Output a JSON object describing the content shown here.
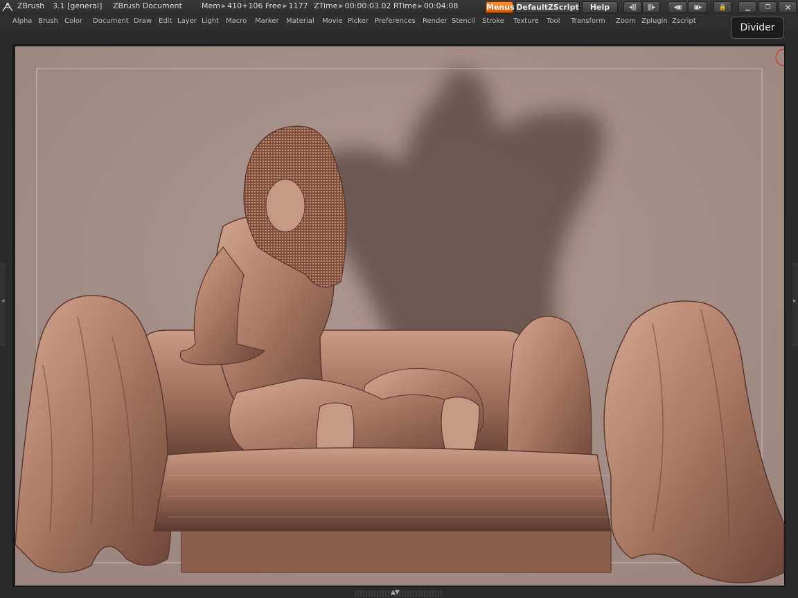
{
  "titlebar": {
    "app": "ZBrush",
    "version": "3.1 [general]",
    "document": "ZBrush Document",
    "mem_label": "Mem",
    "mem_value": "410+106",
    "free_label": "Free",
    "free_value": "1177",
    "ztime_label": "ZTime",
    "ztime_value": "00:00:03.02",
    "rtime_label": "RTime",
    "rtime_value": "00:04:08"
  },
  "buttons": {
    "menus": "Menus",
    "script": "DefaultZScript",
    "help": "Help"
  },
  "menu": [
    "Alpha",
    "Brush",
    "Color",
    "Document",
    "Draw",
    "Edit",
    "Layer",
    "Light",
    "Macro",
    "Marker",
    "Material",
    "Movie",
    "Picker",
    "Preferences",
    "Render",
    "Stencil",
    "Stroke",
    "Texture",
    "Tool",
    "Transform",
    "Zoom",
    "Zplugin",
    "Zscript"
  ],
  "tooltip": "Divider",
  "icons": {
    "logo": "zbrush-logo-icon",
    "tray_arrows": "expand-tray-icon"
  },
  "colors": {
    "accent": "#e06a10",
    "background": "#a48d86",
    "clay": "#b58a78"
  }
}
